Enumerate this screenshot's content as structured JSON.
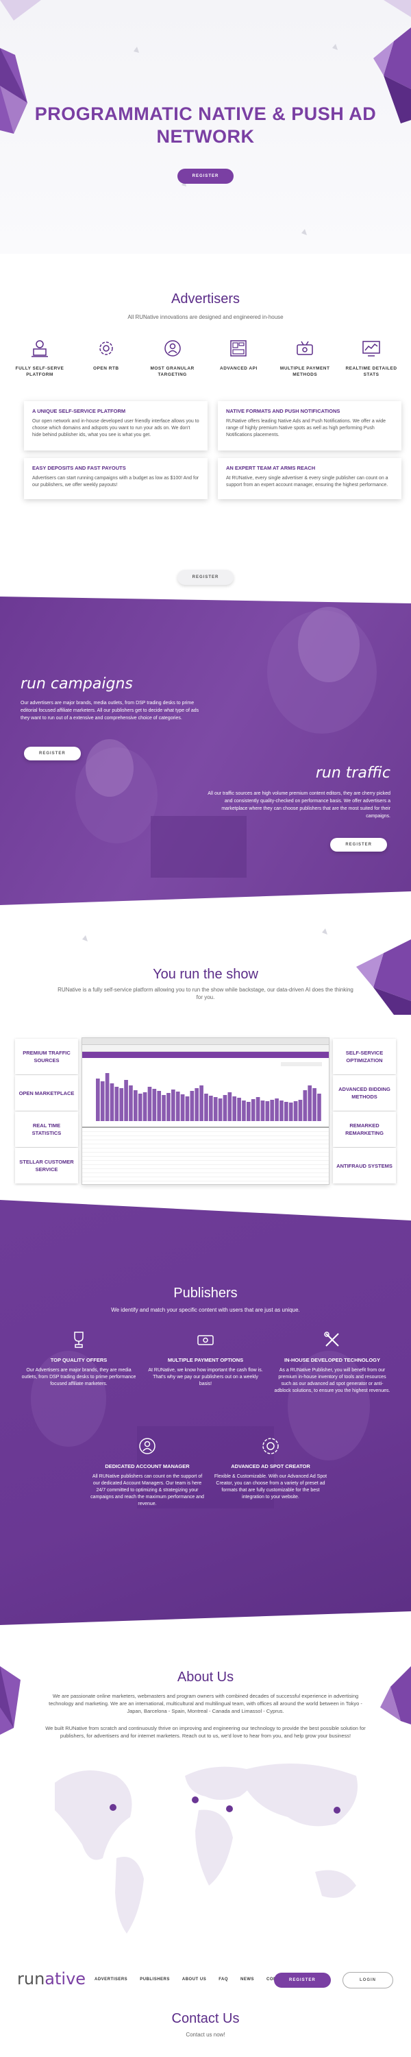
{
  "hero": {
    "title": "PROGRAMMATIC NATIVE & PUSH AD NETWORK",
    "register_label": "REGISTER"
  },
  "advertisers": {
    "title": "Advertisers",
    "subtitle": "All RUNative innovations are designed and engineered in-house",
    "features": [
      {
        "icon": "user-laptop-icon",
        "label": "FULLY SELF-SERVE PLATFORM"
      },
      {
        "icon": "gear-icon",
        "label": "OPEN RTB"
      },
      {
        "icon": "target-person-icon",
        "label": "MOST GRANULAR TARGETING"
      },
      {
        "icon": "dashboard-icon",
        "label": "ADVANCED API"
      },
      {
        "icon": "payment-icon",
        "label": "MULTIPLE PAYMENT METHODS"
      },
      {
        "icon": "stats-monitor-icon",
        "label": "REALTIME DETAILED STATS"
      }
    ],
    "cards": [
      {
        "title": "A UNIQUE SELF-SERVICE PLATFORM",
        "text": "Our open network and in-house developed user friendly interface allows you to choose which domains and adspots you want to run your ads on. We don't hide behind publisher ids, what you see is what you get."
      },
      {
        "title": "NATIVE FORMATS AND PUSH NOTIFICATIONS",
        "text": "RUNative offers leading Native Ads and Push Notifications. We offer a wide range of highly premium Native spots as well as high performing Push Notifications placements."
      },
      {
        "title": "EASY DEPOSITS AND FAST PAYOUTS",
        "text": "Advertisers can start running campaigns with a budget as low as $100! And for our publishers, we offer weekly payouts!"
      },
      {
        "title": "AN EXPERT TEAM AT ARMS REACH",
        "text": "At RUNative, every single advertiser & every single publisher can count on a support from an expert account manager, ensuring the highest performance."
      }
    ],
    "register_label": "REGISTER"
  },
  "run": {
    "campaigns_title": "run campaigns",
    "campaigns_text": "Our advertisers are major brands, media outlets, from DSP trading desks to prime editorial focused affiliate marketers. All our publishers get to decide what type of ads they want to run out of a extensive and comprehensive choice of categories.",
    "campaigns_register": "REGISTER",
    "traffic_title": "run traffic",
    "traffic_text": "All our traffic sources are high volume premium content editors, they are cherry picked and consistently quality-checked on performance basis. We offer advertisers a marketplace where they can choose publishers that are the most suited for their campaigns.",
    "traffic_register": "REGISTER"
  },
  "show": {
    "title": "You run the show",
    "subtitle": "RUNative is a fully self-service platform allowing you to run the show while backstage, our data-driven AI does the thinking for you.",
    "left_boxes": [
      "PREMIUM TRAFFIC SOURCES",
      "OPEN MARKETPLACE",
      "REAL TIME STATISTICS",
      "STELLAR CUSTOMER SERVICE"
    ],
    "right_boxes": [
      "SELF-SERVICE OPTIMIZATION",
      "ADVANCED BIDDING METHODS",
      "REMARKED REMARKETING",
      "ANTIFRAUD SYSTEMS"
    ],
    "accent": "#7a3fa3"
  },
  "publishers": {
    "title": "Publishers",
    "subtitle": "We identify and match your specific content with users that are just as unique.",
    "features": [
      {
        "icon": "trophy-icon",
        "title": "TOP QUALITY OFFERS",
        "text": "Our Advertisers are major brands, they are media outlets, from DSP trading desks to prime performance focused affiliate marketers."
      },
      {
        "icon": "money-icon",
        "title": "MULTIPLE PAYMENT OPTIONS",
        "text": "At RUNative, we know how important the cash flow is. That's why we pay our publishers out on a weekly basis!"
      },
      {
        "icon": "tools-icon",
        "title": "IN-HOUSE DEVELOPED TECHNOLOGY",
        "text": "As a RUNative Publisher, you will benefit from our premium in-house inventory of tools and resources such as our advanced ad spot generator or anti-adblock solutions, to ensure you the highest revenues."
      },
      {
        "icon": "manager-icon",
        "title": "DEDICATED ACCOUNT MANAGER",
        "text": "All RUNative publishers can count on the support of our dedicated Account Managers. Our team is here 24/7 committed to optimizing & strategizing your campaigns and reach the maximum performance and revenue."
      },
      {
        "icon": "ad-gear-icon",
        "title": "ADVANCED AD SPOT CREATOR",
        "text": "Flexible & Customizable. With our Advanced Ad Spot Creator, you can choose from a variety of preset ad formats that are fully customizable for the best integration to your website."
      }
    ]
  },
  "about": {
    "title": "About Us",
    "p1": "We are passionate online marketers, webmasters and program owners with combined decades of successful experience in advertising technology and marketing. We are an international, multicultural and multilingual team, with offices all around the world between in Tokyo - Japan, Barcelona - Spain, Montreal - Canada and Limassol - Cyprus.",
    "p2": "We built RUNative from scratch and continuously thrive on improving and engineering our technology to provide the best possible solution for publishers, for advertisers and for internet marketers. Reach out to us, we'd love to hear from you, and help grow your business!"
  },
  "nav": {
    "logo_run": "run",
    "logo_ative": "ative",
    "links": [
      "ADVERTISERS",
      "PUBLISHERS",
      "ABOUT US",
      "FAQ",
      "NEWS",
      "CONTACT US"
    ],
    "register_label": "REGISTER",
    "login_label": "LOGIN"
  },
  "contact": {
    "title": "Contact Us",
    "subtitle": "Contact us now!"
  }
}
